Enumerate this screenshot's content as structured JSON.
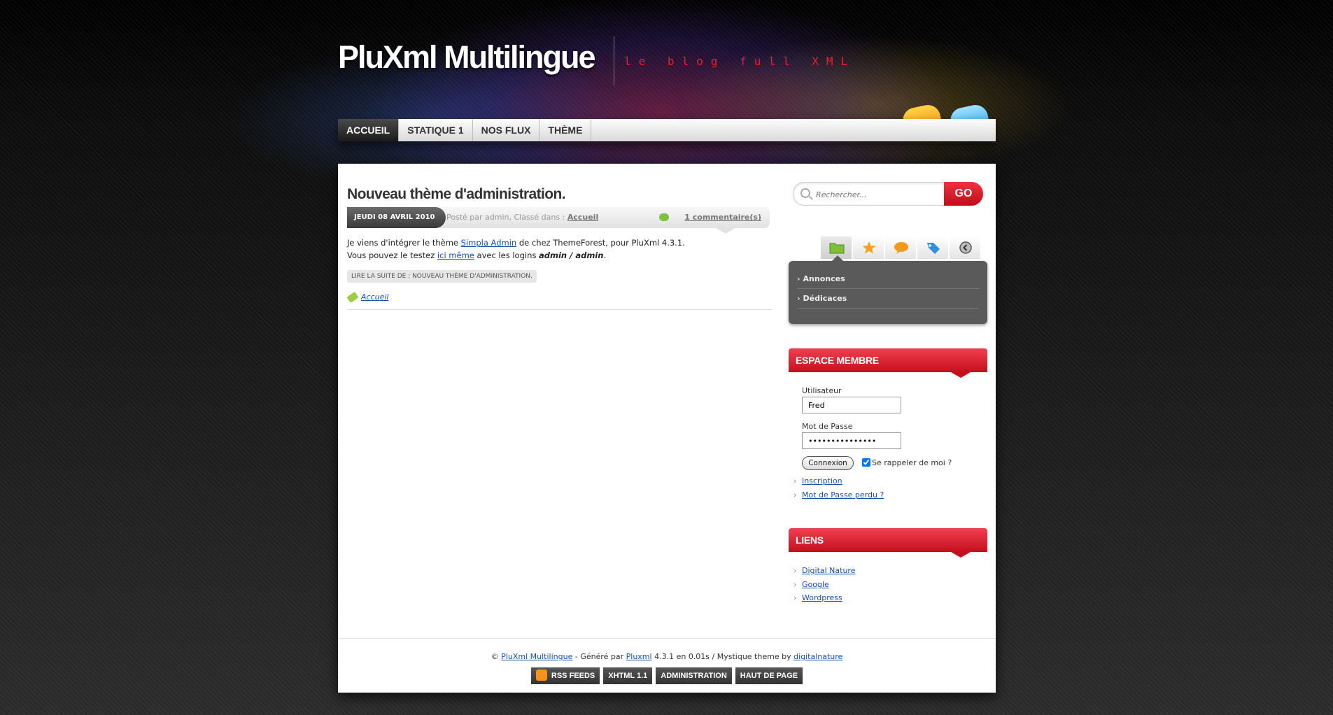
{
  "header": {
    "title": "PluXml Multilingue",
    "tagline": "le blog full XML"
  },
  "nav": {
    "items": [
      {
        "label": "ACCUEIL",
        "active": true
      },
      {
        "label": "STATIQUE 1"
      },
      {
        "label": "NOS FLUX"
      },
      {
        "label": "THÈME"
      }
    ]
  },
  "post": {
    "title": "Nouveau thème d'administration.",
    "date": "JEUDI 08 AVRIL 2010",
    "meta_prefix": "Posté par admin, Classé dans :",
    "meta_category": "Accueil",
    "comments": "1 commentaire(s)",
    "body_line1_pre": "Je viens d'intégrer le thème",
    "body_line1_link": "Simpla Admin",
    "body_line1_post": "de chez ThemeForest, pour PluXml 4.3.1.",
    "body_line2_pre": "Vous pouvez le testez",
    "body_line2_link": "ici même",
    "body_line2_mid": "avec les logins",
    "body_line2_bold": "admin / admin",
    "body_line2_end": ".",
    "read_more": "LIRE LA SUITE DE : NOUVEAU THÈME D'ADMINISTRATION.",
    "tag": "Accueil"
  },
  "sidebar": {
    "search": {
      "placeholder": "Rechercher...",
      "button": "GO"
    },
    "categories": [
      "Annonces",
      "Dédicaces"
    ],
    "member": {
      "title": "ESPACE MEMBRE",
      "user_label": "Utilisateur",
      "user_value": "Fred",
      "pass_label": "Mot de Passe",
      "pass_value": "•••••••••••••••",
      "login_button": "Connexion",
      "remember": "Se rappeler de moi ?",
      "links": [
        "Inscription",
        "Mot de Passe perdu ?"
      ]
    },
    "links_widget": {
      "title": "LIENS",
      "links": [
        "Digital Nature",
        "Google",
        "Wordpress"
      ]
    }
  },
  "footer": {
    "copy_pre": "©",
    "site_link": "PluXml Multilingue",
    "gen_text": "- Généré par",
    "pluxml_link": "Pluxml",
    "version_text": "4.3.1 en 0.01s / Mystique theme by",
    "theme_link": "digitalnature",
    "buttons": [
      "RSS FEEDS",
      "XHTML 1.1",
      "ADMINISTRATION",
      "HAUT DE PAGE"
    ]
  },
  "colors": {
    "accent": "#d7141f",
    "nav_active": "#1b1b1b",
    "panel": "#5a5a5a"
  }
}
